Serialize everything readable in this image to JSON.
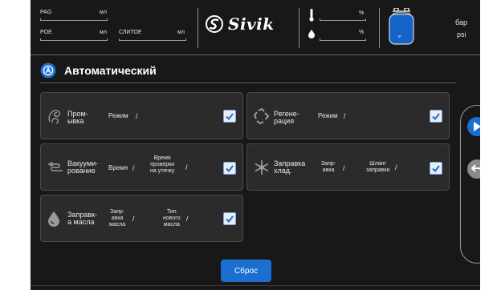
{
  "header": {
    "pag_label": "PAG",
    "pag_unit": "мл",
    "poe_label": "POE",
    "poe_unit": "мл",
    "slitoe_label": "СЛИТОЕ",
    "slitoe_unit": "мл",
    "brand": "Sivik",
    "percent1": "%",
    "percent2": "%",
    "tank_label": "кг",
    "unit_bar": "бар",
    "unit_psi": "psi"
  },
  "title": "Автоматический",
  "cards": {
    "flush": {
      "name": "Пром-\nывка",
      "param1": "Режим",
      "slash1": "/"
    },
    "regen": {
      "name": "Регене-\nрация",
      "param1": "Режим",
      "slash1": "/"
    },
    "vacuum": {
      "name": "Вакууми-\nрование",
      "param1": "Время",
      "slash1": "/",
      "param2": "Время\nпроверки\nна утечку",
      "slash2": "/"
    },
    "refrig": {
      "name": "Заправка\nхлад.",
      "param1": "Запр-\nавка",
      "slash1": "/",
      "param2": "Шланг\nзаправки",
      "slash2": "/"
    },
    "oil": {
      "name": "Заправк-\nа масла",
      "param1": "Запр-\nавка\nмасла",
      "slash1": "/",
      "param2": "Тип\nнового\nмасла",
      "slash2": "/"
    }
  },
  "buttons": {
    "reset": "Сброс"
  },
  "checkboxes": {
    "flush": true,
    "regen": true,
    "vacuum": true,
    "refrig": true,
    "oil": true
  },
  "colors": {
    "accent": "#1a6fd0",
    "background": "#181818",
    "card": "#2b2b2b"
  },
  "icons": [
    "flush-icon",
    "regen-icon",
    "vacuum-icon",
    "refrig-icon",
    "oil-icon",
    "auto-mode-icon",
    "play-icon",
    "back-icon",
    "tank-icon",
    "thermometer-icon",
    "drop-icon"
  ]
}
